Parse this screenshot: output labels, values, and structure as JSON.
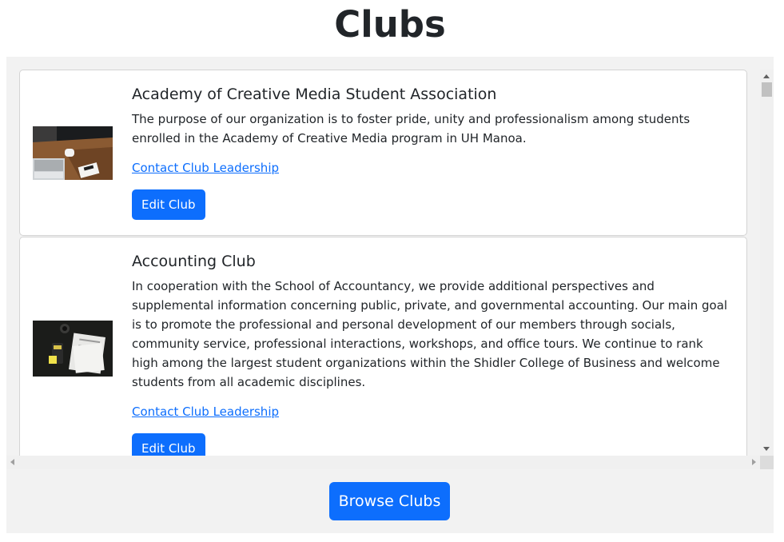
{
  "page": {
    "title": "Clubs"
  },
  "clubs": [
    {
      "name": "Academy of Creative Media Student Association",
      "description": "The purpose of our organization is to foster pride, unity and professionalism among students enrolled in the Academy of Creative Media program in UH Manoa.",
      "contact_label": "Contact Club Leadership",
      "edit_label": "Edit Club",
      "image_icon": "laptop-desk-photo"
    },
    {
      "name": "Accounting Club",
      "description": "In cooperation with the School of Accountancy, we provide additional perspectives and supplemental information concerning public, private, and governmental accounting. Our main goal is to promote the professional and personal development of our members through socials, community service, professional interactions, workshops, and office tours. We continue to rank high among the largest student organizations within the Shidler College of Business and welcome students from all academic disciplines.",
      "contact_label": "Contact Club Leadership",
      "edit_label": "Edit Club",
      "image_icon": "calculator-papers-photo"
    }
  ],
  "footer": {
    "browse_label": "Browse Clubs"
  },
  "colors": {
    "primary": "#0d6efd",
    "panel_bg": "#f2f2f2",
    "text": "#212529"
  }
}
